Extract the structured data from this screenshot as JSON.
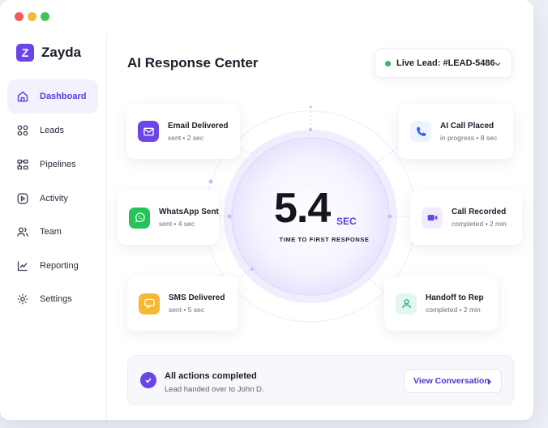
{
  "app": {
    "name": "Zayda",
    "logo_letter": "Z"
  },
  "sidebar": {
    "items": [
      {
        "label": "Dashboard",
        "icon": "home-icon",
        "active": true
      },
      {
        "label": "Leads",
        "icon": "grid-icon"
      },
      {
        "label": "Pipelines",
        "icon": "pipeline-icon"
      },
      {
        "label": "Activity",
        "icon": "activity-icon"
      },
      {
        "label": "Team",
        "icon": "team-icon"
      },
      {
        "label": "Reporting",
        "icon": "chart-icon"
      },
      {
        "label": "Settings",
        "icon": "gear-icon"
      }
    ]
  },
  "header": {
    "title": "AI Response Center",
    "live_lead": "Live Lead: #LEAD-5486"
  },
  "metric": {
    "value": "5.4",
    "unit": "SEC",
    "label": "TIME TO FIRST RESPONSE"
  },
  "cards": {
    "email": {
      "title": "Email Delivered",
      "sub": "sent • 2 sec"
    },
    "call": {
      "title": "AI Call Placed",
      "sub": "in progress • 8 sec"
    },
    "whatsapp": {
      "title": "WhatsApp Sent",
      "sub": "sent • 4 sec"
    },
    "recorded": {
      "title": "Call Recorded",
      "sub": "completed • 2 min"
    },
    "sms": {
      "title": "SMS Delivered",
      "sub": "sent • 5 sec"
    },
    "handoff": {
      "title": "Handoff to Rep",
      "sub": "completed • 2 min"
    }
  },
  "footer": {
    "title": "All actions completed",
    "sub": "Lead handed over to John D.",
    "button": "View Conversation"
  },
  "colors": {
    "accent": "#6a45e8",
    "live": "#2fbf5a",
    "whatsapp": "#25c35a",
    "sms": "#f7b731",
    "handoff": "#19b59a"
  }
}
